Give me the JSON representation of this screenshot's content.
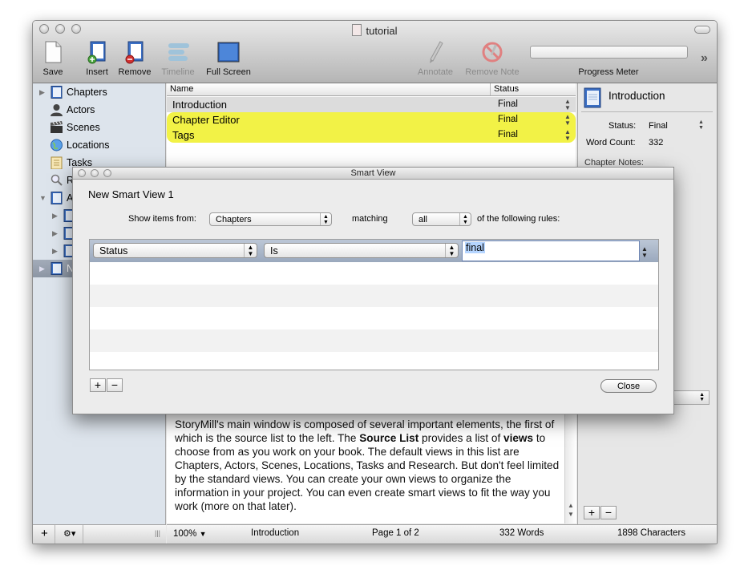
{
  "window": {
    "title": "tutorial"
  },
  "toolbar": {
    "save": "Save",
    "insert": "Insert",
    "remove": "Remove",
    "timeline": "Timeline",
    "full_screen": "Full Screen",
    "annotate": "Annotate",
    "remove_note": "Remove Note",
    "progress_meter": "Progress Meter",
    "overflow": "»"
  },
  "sidebar": {
    "items": [
      {
        "label": "Chapters"
      },
      {
        "label": "Actors"
      },
      {
        "label": "Scenes"
      },
      {
        "label": "Locations"
      },
      {
        "label": "Tasks"
      },
      {
        "label": "R"
      },
      {
        "label": "A"
      },
      {
        "label": "N"
      }
    ],
    "add": "+",
    "gear": "⚙▾",
    "grip": "|||"
  },
  "table": {
    "headers": {
      "name": "Name",
      "status": "Status"
    },
    "rows": [
      {
        "name": "Introduction",
        "status": "Final"
      },
      {
        "name": "Chapter Editor",
        "status": "Final"
      },
      {
        "name": "Tags",
        "status": "Final"
      }
    ]
  },
  "inspector": {
    "title": "Introduction",
    "status_label": "Status:",
    "status_value": "Final",
    "word_count_label": "Word Count:",
    "word_count_value": "332",
    "chapter_notes_label": "Chapter Notes:",
    "add": "+",
    "remove": "−"
  },
  "editor": {
    "p1": "StoryMill's main window is composed of several important elements, the first of which is the source list to the left. The ",
    "b1": "Source List",
    "p2": " provides a list of ",
    "b2": "views",
    "p3": " to choose from as you work on your book. The default views in this list are Chapters, Actors, Scenes, Locations, Tasks and Research. But don't feel limited by the standard views. You can create your own views to organize the information in your project. You can even create smart views to fit the way you work (more on that later)."
  },
  "statusbar": {
    "zoom": "100%",
    "chapter": "Introduction",
    "page": "Page 1 of 2",
    "words": "332 Words",
    "characters": "1898 Characters"
  },
  "dialog": {
    "title": "Smart View",
    "view_name": "New Smart View 1",
    "show_items_label": "Show items from:",
    "show_items_value": "Chapters",
    "matching_label": "matching",
    "matching_value": "all",
    "rules_suffix": "of the following rules:",
    "rule": {
      "field": "Status",
      "operator": "Is",
      "value": "final"
    },
    "add": "+",
    "remove": "−",
    "close": "Close"
  }
}
